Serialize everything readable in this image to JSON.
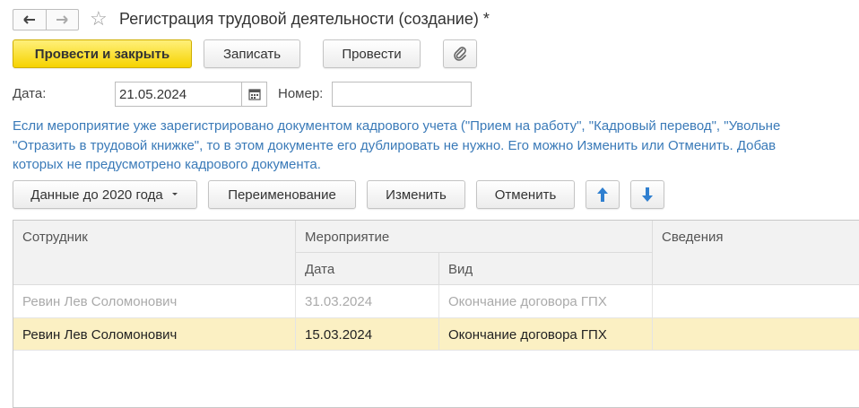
{
  "window": {
    "title": "Регистрация трудовой деятельности (создание) *"
  },
  "toolbar": {
    "post_and_close": "Провести и закрыть",
    "save": "Записать",
    "post": "Провести"
  },
  "form": {
    "date_label": "Дата:",
    "date_value": "21.05.2024",
    "number_label": "Номер:",
    "number_value": ""
  },
  "hint": {
    "line1": "Если мероприятие уже зарегистрировано документом кадрового учета (\"Прием на работу\", \"Кадровый перевод\", \"Увольне",
    "line2": "\"Отразить в трудовой книжке\", то в этом документе его дублировать не нужно. Его можно Изменить или Отменить. Добав",
    "line3": "которых не предусмотрено кадрового документа."
  },
  "table_toolbar": {
    "data_before_2020": "Данные до 2020 года",
    "rename": "Переименование",
    "change": "Изменить",
    "cancel": "Отменить"
  },
  "table": {
    "headers": {
      "employee": "Сотрудник",
      "event": "Мероприятие",
      "date": "Дата",
      "type": "Вид",
      "details": "Сведения"
    },
    "rows": [
      {
        "employee": "Ревин Лев Соломонович",
        "date": "31.03.2024",
        "type": "Окончание договора ГПХ",
        "details": ""
      },
      {
        "employee": "Ревин Лев Соломонович",
        "date": "15.03.2024",
        "type": "Окончание договора ГПХ",
        "details": ""
      }
    ]
  },
  "colors": {
    "primary_button": "#f6d300",
    "hint_text": "#3a7ab8",
    "selected_row": "#fbf0c3",
    "arrow_blue": "#2f7fd0"
  }
}
